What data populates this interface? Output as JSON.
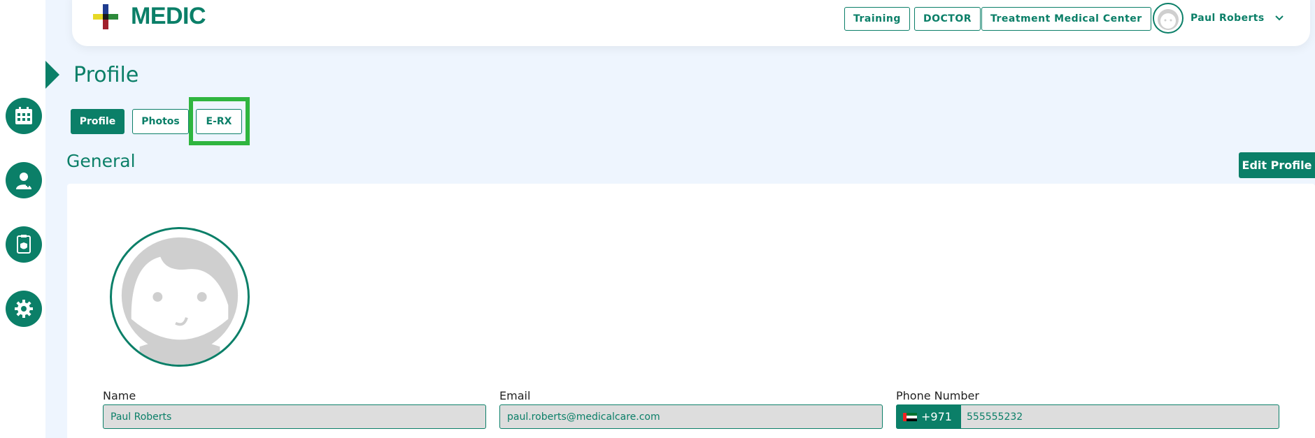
{
  "app": {
    "logo_text": "MEDIC"
  },
  "header": {
    "pills": [
      "Training",
      "DOCTOR",
      "Treatment Medical Center"
    ],
    "user_name": "Paul Roberts"
  },
  "sidebar": {
    "items": [
      {
        "icon": "calendar-icon"
      },
      {
        "icon": "doctor-icon"
      },
      {
        "icon": "medical-record-icon"
      },
      {
        "icon": "gear-icon"
      }
    ]
  },
  "page": {
    "title": "Profile"
  },
  "tabs": [
    {
      "label": "Profile",
      "active": true
    },
    {
      "label": "Photos",
      "active": false
    },
    {
      "label": "E-RX",
      "active": false
    }
  ],
  "section": {
    "title": "General",
    "edit_label": "Edit Profile"
  },
  "form": {
    "name_label": "Name",
    "name_value": "Paul Roberts",
    "email_label": "Email",
    "email_value": "paul.roberts@medicalcare.com",
    "phone_label": "Phone Number",
    "phone_code": "+971",
    "phone_value": "555555232"
  },
  "colors": {
    "primary": "#0b7f68",
    "highlight": "#2fb53f",
    "background": "#eef5fe"
  }
}
